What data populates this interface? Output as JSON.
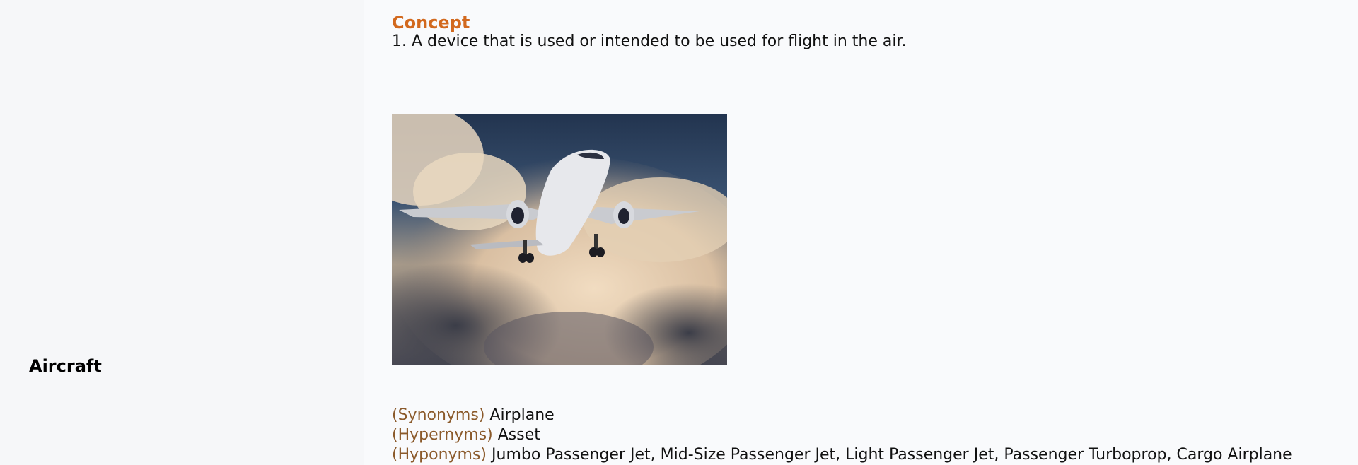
{
  "term": "Aircraft",
  "concept": {
    "heading": "Concept",
    "definition": "1. A device that is used or intended to be used for flight in the air."
  },
  "relations": [
    {
      "label": "(Synonyms)",
      "value": "Airplane"
    },
    {
      "label": "(Hypernyms)",
      "value": "Asset"
    },
    {
      "label": "(Hyponyms)",
      "value": "Jumbo Passenger Jet, Mid-Size Passenger Jet, Light Passenger Jet, Passenger Turboprop, Cargo Airplane"
    }
  ]
}
